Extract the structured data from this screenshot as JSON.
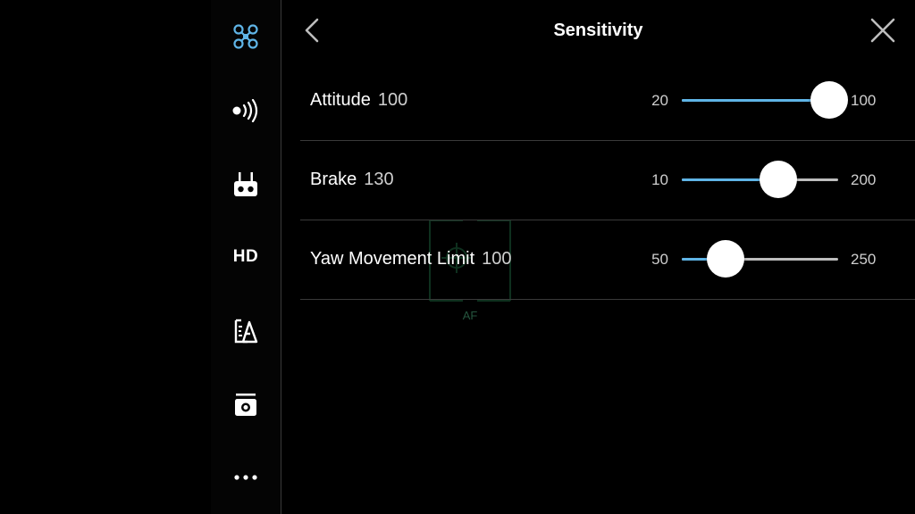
{
  "header": {
    "title": "Sensitivity"
  },
  "rail": {
    "items": [
      {
        "icon": "aircraft-icon",
        "active": true
      },
      {
        "icon": "signal-icon"
      },
      {
        "icon": "remote-controller-icon"
      },
      {
        "icon": "hd-icon",
        "label": "HD"
      },
      {
        "icon": "battery-icon"
      },
      {
        "icon": "camera-icon"
      },
      {
        "icon": "more-icon"
      }
    ]
  },
  "sliders": [
    {
      "label": "Attitude",
      "value": "100",
      "min": "20",
      "max": "100",
      "level": 100
    },
    {
      "label": "Brake",
      "value": "130",
      "min": "10",
      "max": "200",
      "level": 130
    },
    {
      "label": "Yaw Movement Limit",
      "value": "100",
      "min": "50",
      "max": "250",
      "level": 100
    }
  ],
  "overlay": {
    "af_label": "AF"
  },
  "colors": {
    "accent": "#5fb4e6",
    "track": "#bdbdbd",
    "divider": "#3a3a3a",
    "background": "#000000"
  }
}
